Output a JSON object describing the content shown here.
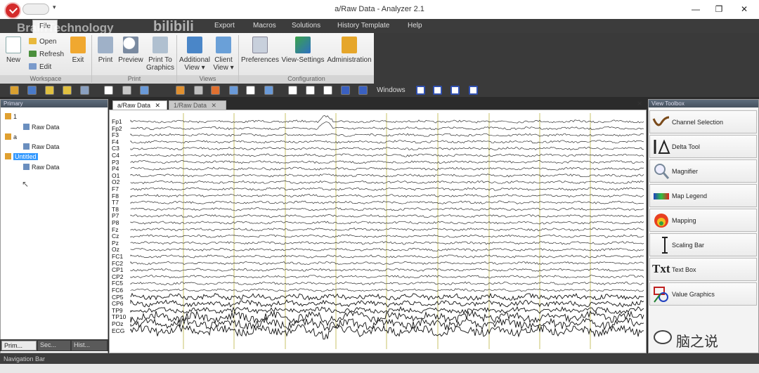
{
  "window": {
    "title": "a/Raw Data - Analyzer 2.1",
    "qat_arrow": "▾",
    "min": "—",
    "max": "❐",
    "close": "✕"
  },
  "watermark": {
    "brand": "BrainTechnology",
    "site": "bilibili",
    "channel": "脑之说"
  },
  "menu": {
    "file": "File",
    "items": [
      "Export",
      "Macros",
      "Solutions",
      "History Template",
      "Help"
    ]
  },
  "ribbon": {
    "new": "New",
    "open": "Open",
    "refresh": "Refresh",
    "edit": "Edit",
    "exit": "Exit",
    "print": "Print",
    "preview": "Preview",
    "print_to": "Print To",
    "graphics": "Graphics",
    "additional": "Additional",
    "view_dd": "View ▾",
    "client": "Client",
    "client_view": "View ▾",
    "preferences": "Preferences",
    "view_settings": "View-Settings",
    "administration": "Administration",
    "groups": {
      "workspace": "Workspace",
      "print": "Print",
      "views": "Views",
      "configuration": "Configuration"
    }
  },
  "toolbar": {
    "windows": "Windows"
  },
  "primary": {
    "title": "Primary",
    "tree": [
      {
        "node": "1",
        "child": "Raw Data"
      },
      {
        "node": "a",
        "child": "Raw Data"
      },
      {
        "node": "Untitled",
        "child": "Raw Data"
      }
    ],
    "tabs": [
      "Prim...",
      "Sec...",
      "Hist..."
    ]
  },
  "doc_tabs": [
    "a/Raw Data",
    "1/Raw Data"
  ],
  "channels": [
    "Fp1",
    "Fp2",
    "F3",
    "F4",
    "C3",
    "C4",
    "P3",
    "P4",
    "O1",
    "O2",
    "F7",
    "F8",
    "T7",
    "T8",
    "P7",
    "P8",
    "Fz",
    "Cz",
    "Pz",
    "Oz",
    "FC1",
    "FC2",
    "CP1",
    "CP2",
    "FC5",
    "FC6",
    "CP5",
    "CP6",
    "TP9",
    "TP10",
    "POz",
    "ECG"
  ],
  "toolbox": {
    "title": "View Toolbox",
    "items": [
      "Channel Selection",
      "Delta Tool",
      "Magnifier",
      "Map Legend",
      "Mapping",
      "Scaling Bar",
      "Text Box",
      "Value Graphics"
    ]
  },
  "navbar": {
    "title": "Navigation Bar"
  },
  "colors": {
    "accent": "#d42b2b",
    "panel_header": "#4f5b68",
    "marker_line": "#c9c36a",
    "selection": "#3399ff"
  }
}
